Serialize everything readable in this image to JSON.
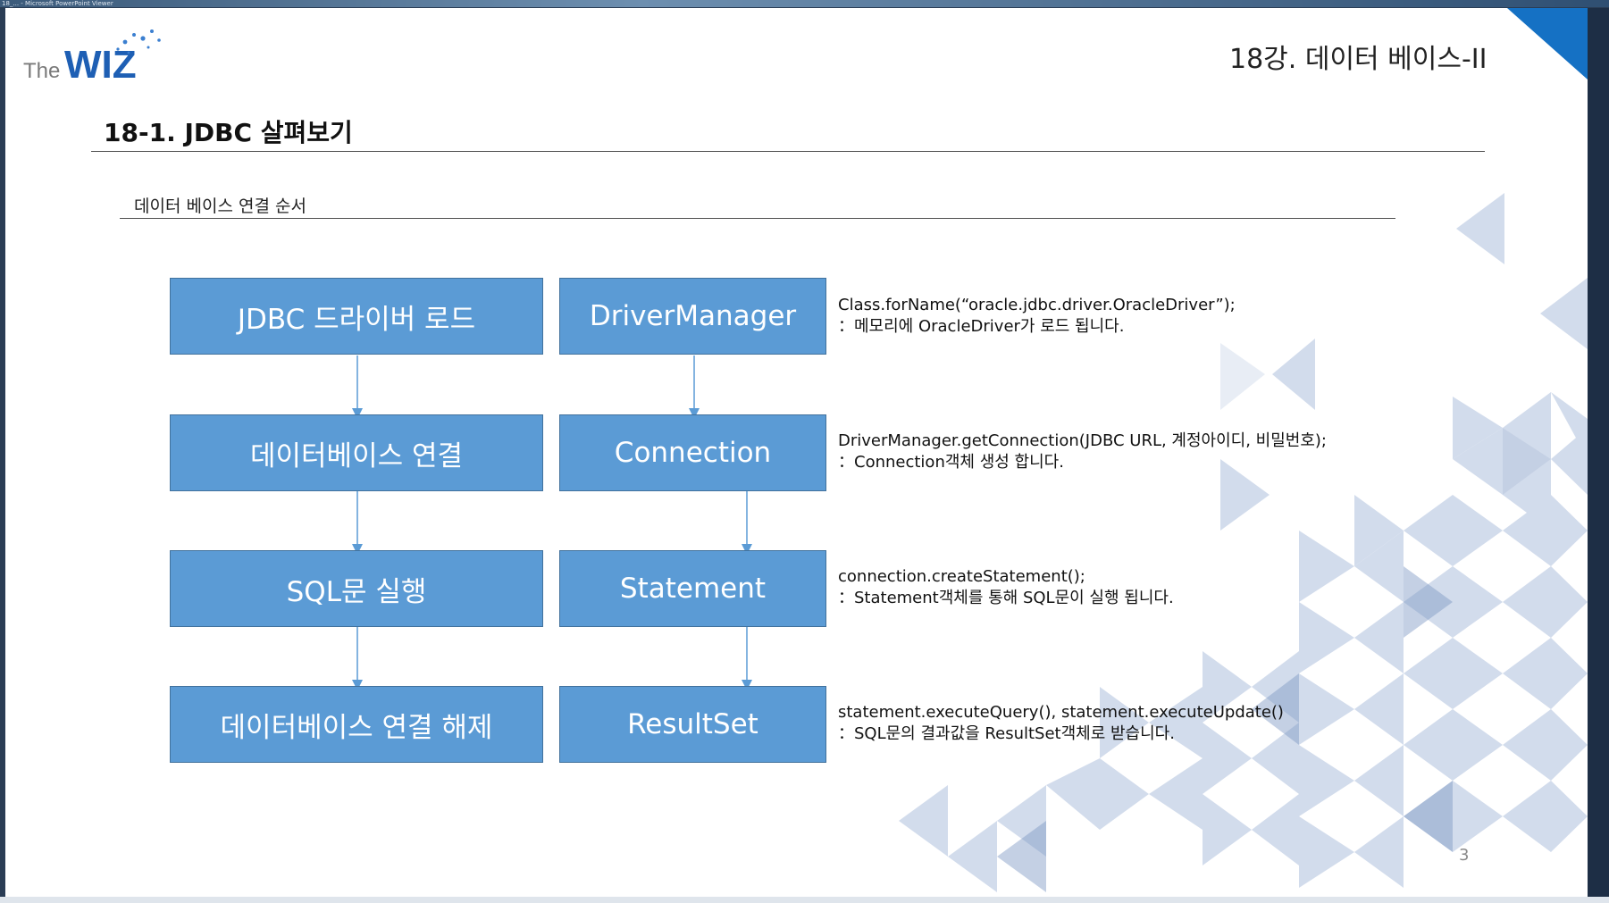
{
  "window": {
    "title": "18_... - Microsoft PowerPoint Viewer"
  },
  "logo": {
    "text_the": "The",
    "text_wiz": "WIZ"
  },
  "slide": {
    "title": "18강. 데이터 베이스-II",
    "section_heading": "18-1. JDBC 살펴보기",
    "subheading": "데이터 베이스 연결 순서",
    "page_number": "3"
  },
  "steps": [
    {
      "step": "JDBC 드라이버 로드",
      "object": "DriverManager",
      "code": "Class.forName(“oracle.jdbc.driver.OracleDriver”);",
      "note": "：메모리에 OracleDriver가 로드 됩니다."
    },
    {
      "step": "데이터베이스 연결",
      "object": "Connection",
      "code": "DriverManager.getConnection(JDBC  URL, 계정아이디,  비밀번호);",
      "note": "：Connection객체 생성 합니다."
    },
    {
      "step": "SQL문 실행",
      "object": "Statement",
      "code": "connection.createStatement();",
      "note": "：Statement객체를 통해 SQL문이 실행 됩니다."
    },
    {
      "step": "데이터베이스 연결 해제",
      "object": "ResultSet",
      "code": "statement.executeQuery(),  statement.executeUpdate()",
      "note": "：SQL문의 결과값을 ResultSet객체로 받습니다."
    }
  ],
  "colors": {
    "box_fill": "#5b9bd5",
    "box_border": "#41719c",
    "corner_accent": "#1571c4",
    "logo_blue": "#1e5fb4"
  }
}
